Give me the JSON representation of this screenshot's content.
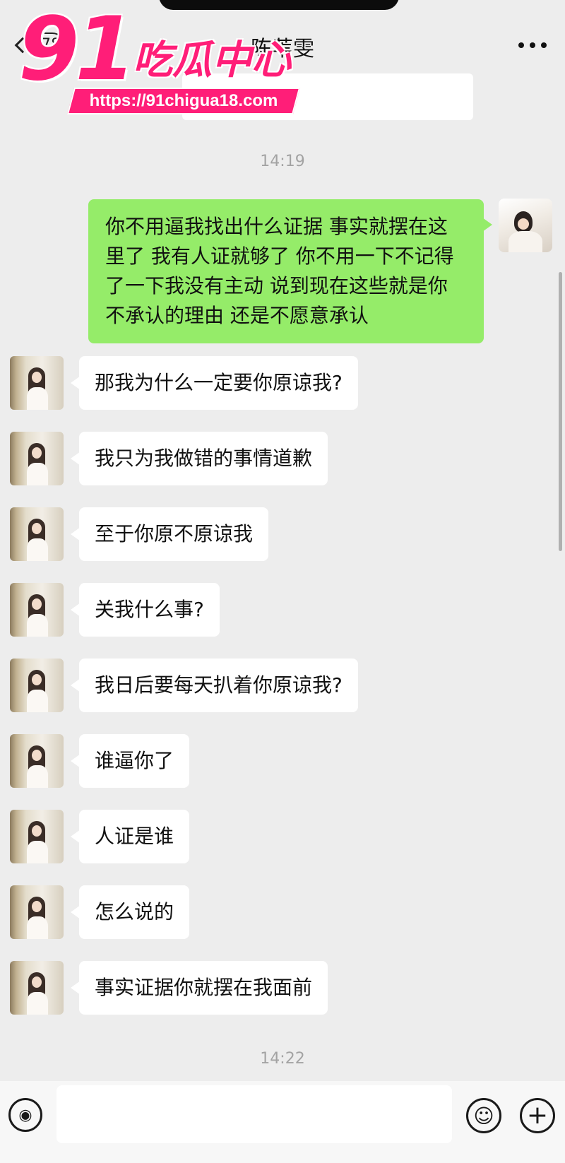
{
  "header": {
    "back_badge": "78",
    "title": "陈苇雯",
    "more_label": "•••"
  },
  "watermark": {
    "number": "91",
    "chinese": "吃瓜中心",
    "url": "https://91chigua18.com"
  },
  "timestamps": [
    "14:19",
    "14:22"
  ],
  "outgoing_messages": [
    "你不用逼我找出什么证据 事实就摆在这里了 我有人证就够了 你不用一下不记得了一下我没有主动 说到现在这些就是你不承认的理由 还是不愿意承认"
  ],
  "incoming_messages": [
    "那我为什么一定要你原谅我?",
    "我只为我做错的事情道歉",
    "至于你原不原谅我",
    "关我什么事?",
    "我日后要每天扒着你原谅我?",
    "谁逼你了",
    "人证是谁",
    "怎么说的",
    "事实证据你就摆在我面前"
  ],
  "input_bar": {
    "voice_icon": "voice-icon",
    "emoji_icon": "emoji-icon",
    "plus_icon": "plus-icon",
    "voice_glyph": "◉",
    "emoji_glyph": "☺",
    "plus_glyph": "+"
  }
}
